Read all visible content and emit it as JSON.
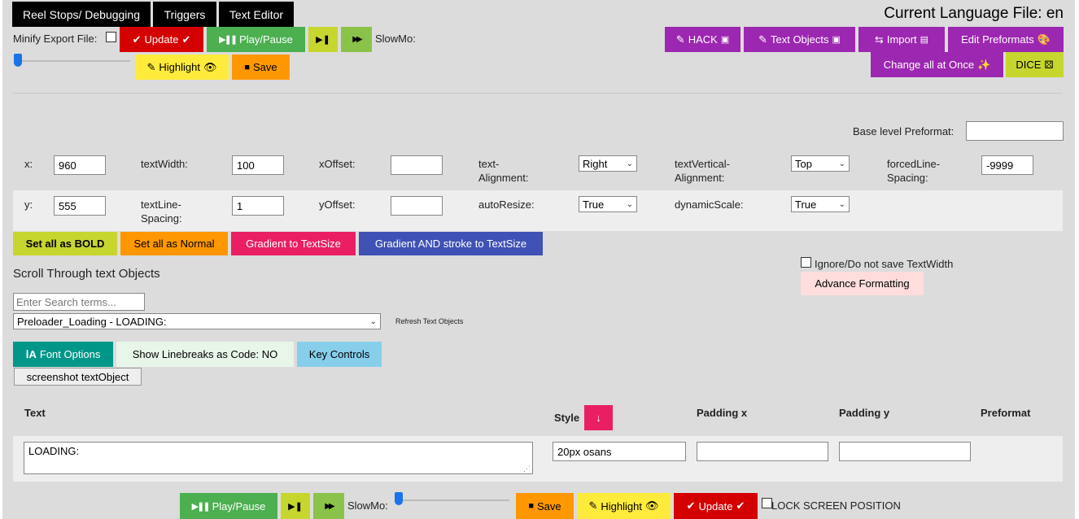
{
  "tabs": [
    "Reel Stops/ Debugging",
    "Triggers",
    "Text Editor"
  ],
  "language_title": "Current Language File: en",
  "minify_label": "Minify Export File:",
  "toolbar": {
    "update": "Update",
    "play_pause": "Play/Pause",
    "slowmo": "SlowMo:",
    "highlight": "Highlight",
    "save": "Save"
  },
  "right_buttons": {
    "hack": "HACK",
    "text_objects": "Text Objects",
    "import": "Import",
    "edit_preformats": "Edit Preformats",
    "change_all": "Change all at Once",
    "dice": "DICE"
  },
  "base_level_label": "Base level Preformat:",
  "fields": {
    "x_label": "x:",
    "x_value": "960",
    "textwidth_label": "textWidth:",
    "textwidth_value": "100",
    "xoffset_label": "xOffset:",
    "xoffset_value": "",
    "text_alignment_label_1": "text-",
    "text_alignment_label_2": "Alignment:",
    "text_alignment_value": "Right",
    "text_vertical_label_1": "textVertical-",
    "text_vertical_label_2": "Alignment:",
    "text_vertical_value": "Top",
    "forced_line_label_1": "forcedLine-",
    "forced_line_label_2": "Spacing:",
    "forced_line_value": "-9999",
    "y_label": "y:",
    "y_value": "555",
    "textline_label_1": "textLine-",
    "textline_label_2": "Spacing:",
    "textline_value": "1",
    "yoffset_label": "yOffset:",
    "yoffset_value": "",
    "autoresize_label": "autoResize:",
    "autoresize_value": "True",
    "dynamicscale_label": "dynamicScale:",
    "dynamicscale_value": "True"
  },
  "format_buttons": {
    "bold": "Set all as BOLD",
    "normal": "Set all as Normal",
    "gradient": "Gradient to TextSize",
    "gradient_stroke": "Gradient AND stroke to TextSize"
  },
  "ignore_label": "Ignore/Do not save TextWidth",
  "advance_formatting": "Advance Formatting",
  "scroll_title": "Scroll Through text Objects",
  "search_placeholder": "Enter Search terms...",
  "selected_object": "Preloader_Loading - LOADING:",
  "refresh_label": "Refresh Text Objects",
  "option_buttons": {
    "font_options": "Font Options",
    "linebreaks": "Show Linebreaks as Code: NO",
    "key_controls": "Key Controls",
    "screenshot": "screenshot textObject"
  },
  "table": {
    "headers": {
      "text": "Text",
      "style": "Style",
      "padding_x": "Padding x",
      "padding_y": "Padding y",
      "preformat": "Preformat"
    },
    "row": {
      "text": "LOADING:",
      "style": "20px osans",
      "padding_x": "",
      "padding_y": ""
    }
  },
  "bottom_bar": {
    "play_pause": "Play/Pause",
    "slowmo": "SlowMo:",
    "save": "Save",
    "highlight": "Highlight",
    "update": "Update",
    "lock": "LOCK SCREEN POSITION"
  }
}
